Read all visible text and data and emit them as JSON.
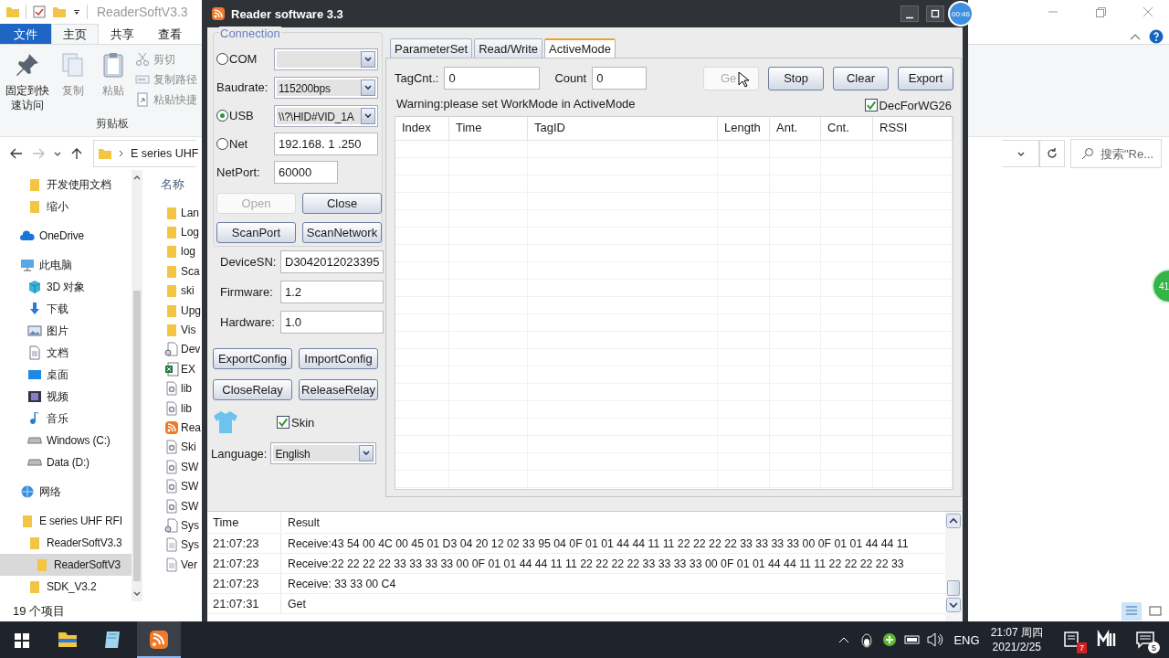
{
  "explorer": {
    "title": "ReaderSoftV3.3",
    "ribbon_tabs": [
      {
        "label": "文件",
        "kind": "file-menu",
        "selected": false
      },
      {
        "label": "主页",
        "kind": "tab",
        "selected": true
      },
      {
        "label": "共享",
        "kind": "tab",
        "selected": false
      },
      {
        "label": "查看",
        "kind": "tab",
        "selected": false
      }
    ],
    "clipboard": {
      "large_buttons": [
        {
          "label": "固定到快速访问",
          "kind": "pin",
          "disabled": false
        },
        {
          "label": "复制",
          "kind": "copy",
          "disabled": true
        },
        {
          "label": "粘贴",
          "kind": "paste",
          "disabled": true
        }
      ],
      "small_buttons": [
        {
          "label": "剪切",
          "kind": "cut",
          "disabled": true
        },
        {
          "label": "复制路径",
          "kind": "path",
          "disabled": true
        },
        {
          "label": "粘贴快捷",
          "kind": "shortcut",
          "disabled": true
        }
      ],
      "group_label": "剪贴板"
    },
    "address": "E series UHF",
    "search": {
      "placeholder": "搜索\"Re..."
    },
    "quick_items": [
      {
        "label": "开发使用文档",
        "kind": "folder",
        "selected": false
      },
      {
        "label": "缩小",
        "kind": "folder",
        "selected": false
      }
    ],
    "nav": [
      {
        "label": "OneDrive",
        "kind": "cloud",
        "selected": false
      },
      {
        "label": "此电脑",
        "kind": "pc",
        "selected": false,
        "children": [
          {
            "label": "3D 对象",
            "kind": "cube",
            "selected": false
          },
          {
            "label": "下载",
            "kind": "download",
            "selected": false
          },
          {
            "label": "图片",
            "kind": "picture",
            "selected": false
          },
          {
            "label": "文档",
            "kind": "doc",
            "selected": false
          },
          {
            "label": "桌面",
            "kind": "desktop",
            "selected": false
          },
          {
            "label": "视频",
            "kind": "video",
            "selected": false
          },
          {
            "label": "音乐",
            "kind": "music",
            "selected": false
          },
          {
            "label": "Windows (C:)",
            "kind": "drive",
            "selected": false
          },
          {
            "label": "Data (D:)",
            "kind": "drive",
            "selected": false
          }
        ]
      },
      {
        "label": "网络",
        "kind": "network",
        "selected": false
      },
      {
        "label": "E series UHF RFI",
        "kind": "folder",
        "selected": false,
        "children": [
          {
            "label": "ReaderSoftV3.3",
            "kind": "folder",
            "selected": false,
            "children": [
              {
                "label": "ReaderSoftV3",
                "kind": "folder",
                "selected": true
              }
            ]
          },
          {
            "label": "SDK_V3.2",
            "kind": "folder",
            "selected": false
          }
        ]
      }
    ],
    "column": "名称",
    "files": [
      {
        "name": "Lan",
        "kind": "folder"
      },
      {
        "name": "Log",
        "kind": "folder"
      },
      {
        "name": "log",
        "kind": "folder"
      },
      {
        "name": "Sca",
        "kind": "folder"
      },
      {
        "name": "ski",
        "kind": "folder"
      },
      {
        "name": "Upg",
        "kind": "folder"
      },
      {
        "name": "Vis",
        "kind": "folder"
      },
      {
        "name": "Dev",
        "kind": "config"
      },
      {
        "name": "EX",
        "kind": "excel"
      },
      {
        "name": "lib",
        "kind": "dll"
      },
      {
        "name": "lib",
        "kind": "dll"
      },
      {
        "name": "Rea",
        "kind": "rss"
      },
      {
        "name": "Ski",
        "kind": "dll"
      },
      {
        "name": "SW",
        "kind": "dll"
      },
      {
        "name": "SW",
        "kind": "dll"
      },
      {
        "name": "SW",
        "kind": "dll"
      },
      {
        "name": "Sys",
        "kind": "config"
      },
      {
        "name": "Sys",
        "kind": "text"
      },
      {
        "name": "Ver",
        "kind": "text"
      }
    ],
    "status": "19 个项目",
    "floating_badge": "41"
  },
  "app": {
    "title": "Reader software 3.3",
    "timer": "00:46",
    "connection": {
      "legend": "Connection",
      "rows": [
        {
          "kind": "radio-select",
          "label": "COM",
          "selected": false
        },
        {
          "kind": "select",
          "label": "Baudrate:",
          "value": "115200bps"
        },
        {
          "kind": "radio-select",
          "label": "USB",
          "selected": true,
          "value": "\\\\?\\HID#VID_1A"
        },
        {
          "kind": "radio-input",
          "label": "Net",
          "selected": false,
          "value": "192.168. 1 .250"
        },
        {
          "kind": "input",
          "label": "NetPort:",
          "value": "60000"
        }
      ],
      "buttons": [
        {
          "label": "Open",
          "disabled": true
        },
        {
          "label": "Close",
          "disabled": false
        },
        {
          "label": "ScanPort",
          "disabled": false
        },
        {
          "label": "ScanNetwork",
          "disabled": false
        }
      ]
    },
    "device": [
      {
        "label": "DeviceSN:",
        "value": "D3042012023395"
      },
      {
        "label": "Firmware:",
        "value": "1.2"
      },
      {
        "label": "Hardware:",
        "value": "1.0"
      }
    ],
    "config_buttons": [
      {
        "label": "ExportConfig",
        "disabled": false
      },
      {
        "label": "ImportConfig",
        "disabled": false
      },
      {
        "label": "CloseRelay",
        "disabled": false
      },
      {
        "label": "ReleaseRelay",
        "disabled": false
      }
    ],
    "skin": {
      "label": "Skin",
      "checked": true
    },
    "language": {
      "label": "Language:",
      "value": "English"
    },
    "tabs": [
      {
        "label": "ParameterSet",
        "selected": false
      },
      {
        "label": "Read/Write",
        "selected": false
      },
      {
        "label": "ActiveMode",
        "selected": true
      }
    ],
    "active": {
      "tagcnt": {
        "label": "TagCnt.:",
        "value": "0"
      },
      "count": {
        "label": "Count",
        "value": "0"
      },
      "buttons": [
        {
          "label": "Ge",
          "disabled": true
        },
        {
          "label": "Stop",
          "disabled": false
        },
        {
          "label": "Clear",
          "disabled": false
        },
        {
          "label": "Export",
          "disabled": false
        }
      ],
      "warning": "Warning:please set WorkMode in ActiveMode",
      "dec": {
        "label": "DecForWG26",
        "checked": true
      },
      "columns": [
        "Index",
        "Time",
        "TagID",
        "Length",
        "Ant.",
        "Cnt.",
        "RSSI"
      ]
    },
    "log": {
      "columns": [
        "Time",
        "Result"
      ],
      "rows": [
        {
          "time": "21:07:23",
          "result": "Receive:43 54 00 4C 00 45 01 D3 04 20 12 02 33 95 04 0F 01 01 44 44 11 11 22 22 22 22 33 33 33 33 00 0F 01 01 44 44 11"
        },
        {
          "time": "21:07:23",
          "result": "Receive:22 22 22 22 33 33 33 33 00 0F 01 01 44 44 11 11 22 22 22 22 33 33 33 33 00 0F 01 01 44 44 11 11 22 22 22 22 33"
        },
        {
          "time": "21:07:23",
          "result": "Receive: 33 33 00 C4"
        },
        {
          "time": "21:07:31",
          "result": "Get"
        }
      ]
    }
  },
  "taskbar": {
    "language": "ENG",
    "time": "21:07 周四",
    "date": "2021/2/25",
    "notification_count": "7",
    "action_count": "5"
  }
}
